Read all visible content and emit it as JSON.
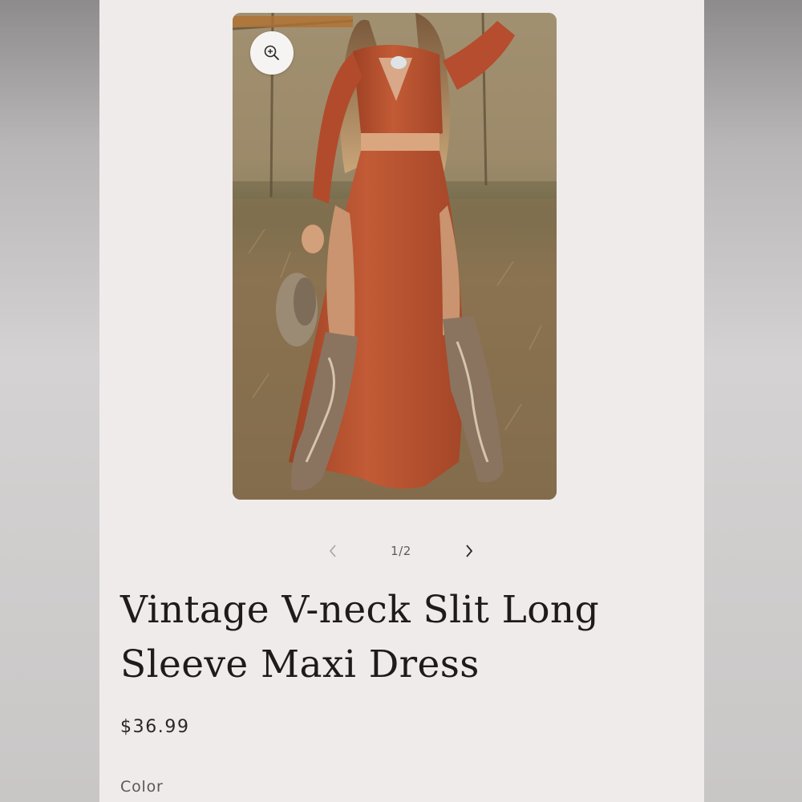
{
  "gallery": {
    "current": 1,
    "total": 2,
    "counter_text": "1/2",
    "zoom_icon": "zoom-in-icon",
    "prev_icon": "chevron-left-icon",
    "next_icon": "chevron-right-icon"
  },
  "product": {
    "title": "Vintage V-neck Slit Long Sleeve Maxi Dress",
    "price": "$36.99",
    "color_label": "Color"
  },
  "colors": {
    "page_background": "#efebea",
    "text": "#1d1b1b",
    "dress": "#b5502f"
  }
}
